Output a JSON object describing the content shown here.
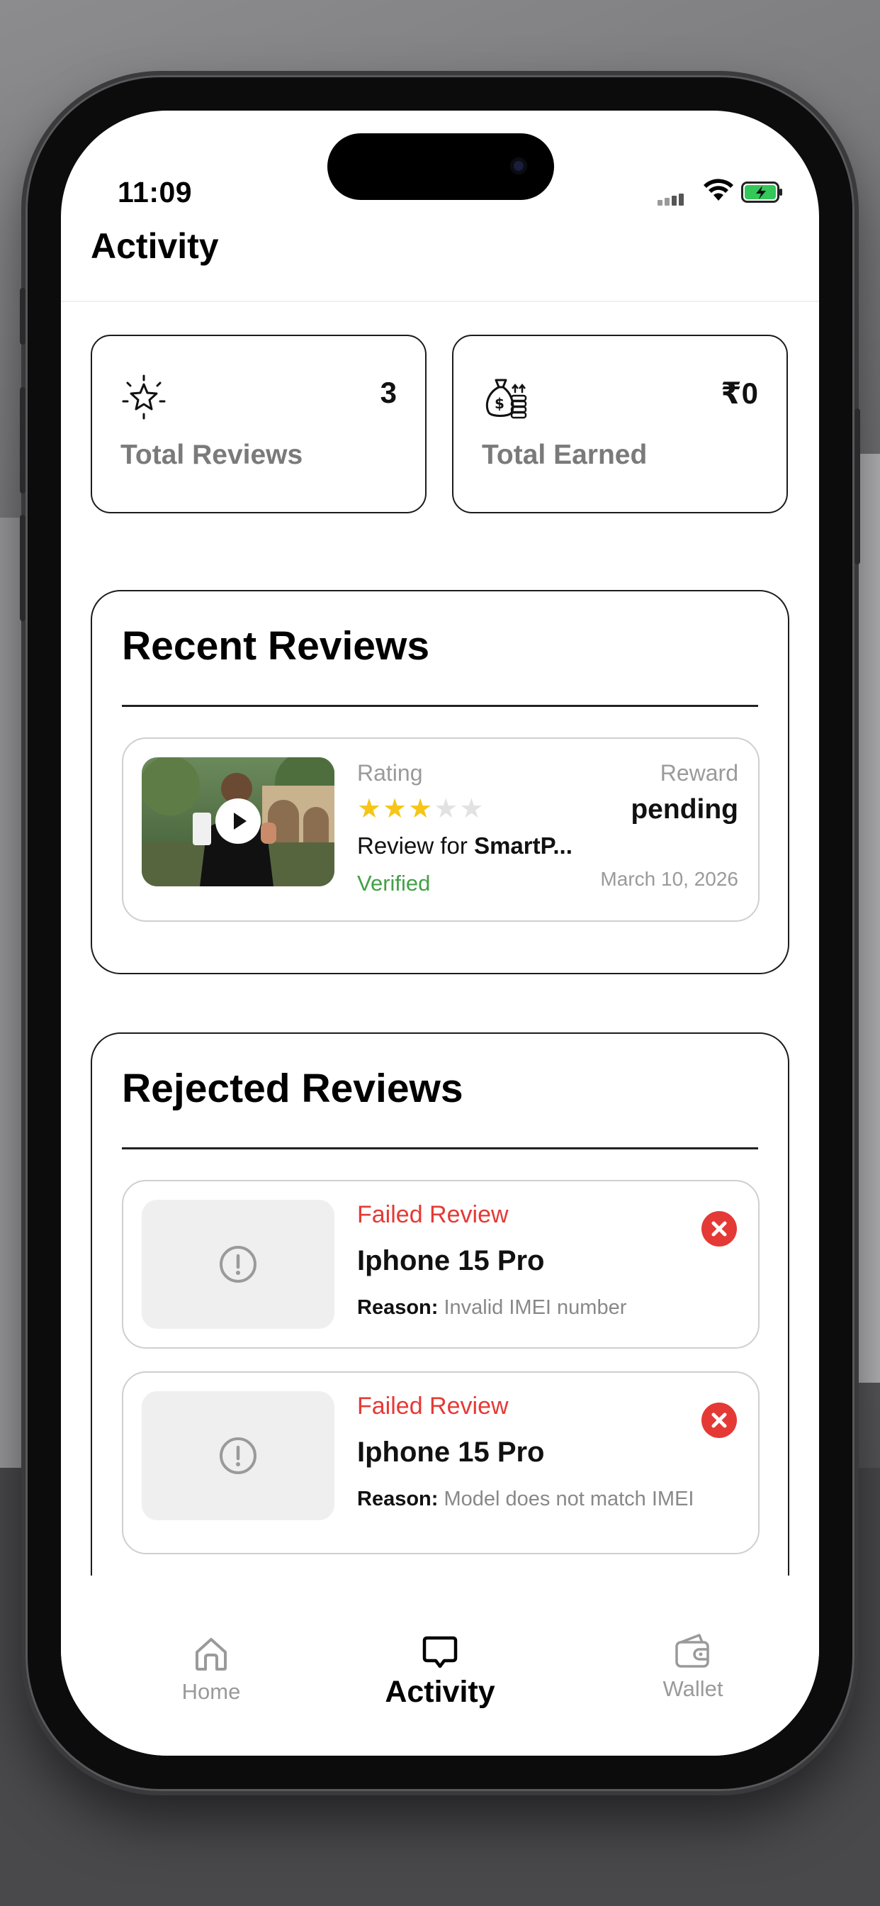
{
  "status_bar": {
    "time": "11:09"
  },
  "header": {
    "title": "Activity"
  },
  "stats": [
    {
      "icon": "sparkle-star-icon",
      "value": "3",
      "label": "Total Reviews"
    },
    {
      "icon": "money-bag-icon",
      "value": "₹0",
      "label": "Total Earned"
    }
  ],
  "recent_reviews": {
    "title": "Recent Reviews",
    "items": [
      {
        "rating_label": "Rating",
        "rating": 3,
        "rating_max": 5,
        "review_for_prefix": "Review for ",
        "product": "SmartP...",
        "status": "Verified",
        "reward_label": "Reward",
        "reward_value": "pending",
        "date": "March 10, 2026"
      }
    ]
  },
  "rejected_reviews": {
    "title": "Rejected Reviews",
    "items": [
      {
        "status": "Failed Review",
        "product": "Iphone 15 Pro",
        "reason_label": "Reason:",
        "reason": "Invalid IMEI number"
      },
      {
        "status": "Failed Review",
        "product": "Iphone 15 Pro",
        "reason_label": "Reason:",
        "reason": "Model does not match IMEI"
      }
    ]
  },
  "tab_bar": {
    "tabs": [
      {
        "label": "Home",
        "icon": "home-icon",
        "active": false
      },
      {
        "label": "Activity",
        "icon": "chat-bubble-icon",
        "active": true
      },
      {
        "label": "Wallet",
        "icon": "wallet-icon",
        "active": false
      }
    ]
  },
  "colors": {
    "star": "#f5c518",
    "verified": "#43a047",
    "failed": "#e53935",
    "inactive_tab": "#9a9a9a"
  }
}
